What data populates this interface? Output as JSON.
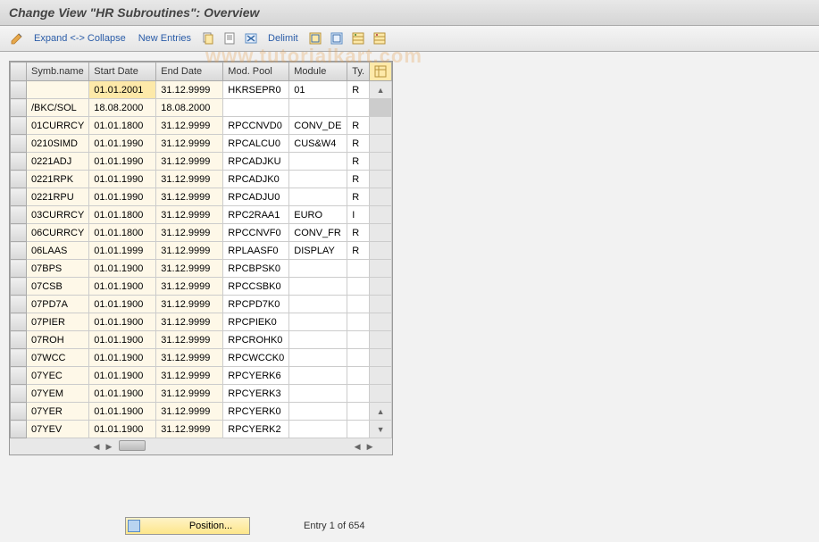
{
  "title": "Change View \"HR Subroutines\": Overview",
  "toolbar": {
    "expand_collapse": "Expand <-> Collapse",
    "new_entries": "New Entries",
    "delimit": "Delimit"
  },
  "columns": {
    "symb": "Symb.name",
    "start": "Start Date",
    "end": "End Date",
    "pool": "Mod. Pool",
    "module": "Module",
    "ty": "Ty."
  },
  "rows": [
    {
      "symb": "",
      "start": "01.01.2001",
      "end": "31.12.9999",
      "pool": "HKRSEPR0",
      "module": "01",
      "ty": "R",
      "hl": true
    },
    {
      "symb": "/BKC/SOL",
      "start": "18.08.2000",
      "end": "18.08.2000",
      "pool": "",
      "module": "",
      "ty": ""
    },
    {
      "symb": "01CURRCY",
      "start": "01.01.1800",
      "end": "31.12.9999",
      "pool": "RPCCNVD0",
      "module": "CONV_DE",
      "ty": "R"
    },
    {
      "symb": "0210SIMD",
      "start": "01.01.1990",
      "end": "31.12.9999",
      "pool": "RPCALCU0",
      "module": "CUS&W4",
      "ty": "R"
    },
    {
      "symb": "0221ADJ",
      "start": "01.01.1990",
      "end": "31.12.9999",
      "pool": "RPCADJKU",
      "module": "",
      "ty": "R"
    },
    {
      "symb": "0221RPK",
      "start": "01.01.1990",
      "end": "31.12.9999",
      "pool": "RPCADJK0",
      "module": "",
      "ty": "R"
    },
    {
      "symb": "0221RPU",
      "start": "01.01.1990",
      "end": "31.12.9999",
      "pool": "RPCADJU0",
      "module": "",
      "ty": "R"
    },
    {
      "symb": "03CURRCY",
      "start": "01.01.1800",
      "end": "31.12.9999",
      "pool": "RPC2RAA1",
      "module": "EURO",
      "ty": "I"
    },
    {
      "symb": "06CURRCY",
      "start": "01.01.1800",
      "end": "31.12.9999",
      "pool": "RPCCNVF0",
      "module": "CONV_FR",
      "ty": "R"
    },
    {
      "symb": "06LAAS",
      "start": "01.01.1999",
      "end": "31.12.9999",
      "pool": "RPLAASF0",
      "module": "DISPLAY",
      "ty": "R"
    },
    {
      "symb": "07BPS",
      "start": "01.01.1900",
      "end": "31.12.9999",
      "pool": "RPCBPSK0",
      "module": "",
      "ty": ""
    },
    {
      "symb": "07CSB",
      "start": "01.01.1900",
      "end": "31.12.9999",
      "pool": "RPCCSBK0",
      "module": "",
      "ty": ""
    },
    {
      "symb": "07PD7A",
      "start": "01.01.1900",
      "end": "31.12.9999",
      "pool": "RPCPD7K0",
      "module": "",
      "ty": ""
    },
    {
      "symb": "07PIER",
      "start": "01.01.1900",
      "end": "31.12.9999",
      "pool": "RPCPIEK0",
      "module": "",
      "ty": ""
    },
    {
      "symb": "07ROH",
      "start": "01.01.1900",
      "end": "31.12.9999",
      "pool": "RPCROHK0",
      "module": "",
      "ty": ""
    },
    {
      "symb": "07WCC",
      "start": "01.01.1900",
      "end": "31.12.9999",
      "pool": "RPCWCCK0",
      "module": "",
      "ty": ""
    },
    {
      "symb": "07YEC",
      "start": "01.01.1900",
      "end": "31.12.9999",
      "pool": "RPCYERK6",
      "module": "",
      "ty": ""
    },
    {
      "symb": "07YEM",
      "start": "01.01.1900",
      "end": "31.12.9999",
      "pool": "RPCYERK3",
      "module": "",
      "ty": ""
    },
    {
      "symb": "07YER",
      "start": "01.01.1900",
      "end": "31.12.9999",
      "pool": "RPCYERK0",
      "module": "",
      "ty": ""
    },
    {
      "symb": "07YEV",
      "start": "01.01.1900",
      "end": "31.12.9999",
      "pool": "RPCYERK2",
      "module": "",
      "ty": ""
    }
  ],
  "footer": {
    "position": "Position...",
    "entry_info": "Entry 1 of 654"
  }
}
